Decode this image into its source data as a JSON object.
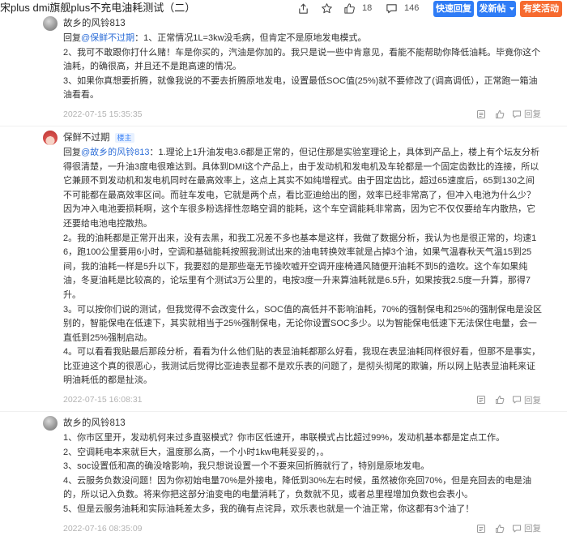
{
  "header": {
    "title": "宋plus dmi旗舰plus不充电油耗测试（二）",
    "share_icon": "share-icon",
    "favorite_icon": "star-icon",
    "like_icon": "thumb-up-icon",
    "like_count": "18",
    "comment_icon": "comment-icon",
    "comment_count": "146",
    "quick_reply_label": "快速回复",
    "new_post_label": "发新帖",
    "event_label": "有奖活动"
  },
  "posts": [
    {
      "author": "故乡的风铃813",
      "reply_prefix": "回复",
      "mention": "@保鲜不过期",
      "paragraphs": [
        "：1、正常情况1L=3kw没毛病，但肯定不是原地发电模式。",
        "2、我可不敢跟你打什么赌！车是你买的，汽油是你加的。我只是说一些中肯意见，看能不能帮助你降低油耗。毕竟你这个油耗，的确很高，并且还不是跑高速的情况。",
        "3、如果你真想要折腾，就像我说的不要去折腾原地发电，设置最低SOC值(25%)就不要修改了(调高调低），正常跑一箱油油看看。"
      ],
      "timestamp": "2022-07-15 15:35:35",
      "reply_label": "回复"
    },
    {
      "author": "保鲜不过期",
      "badge": "楼主",
      "reply_prefix": "回复",
      "mention": "@故乡的风铃813",
      "paragraphs": [
        "：1.理论上1升油发电3.6都是正常的，但记住那是实验室理论上，具体到产品上，楼上有个坛友分析得很清楚，一升油3度电很难达到。具体到DMI这个产品上，由于发动机和发电机及车轮都是一个固定齿数比的连接，所以它兼顾不到发动机和发电机同时在最高效率上，这点上其实不如纯增程式。由于固定齿比，超过65速度后，65到130之间不可能都在最高效率区间。而驻车发电，它就是两个点，看比亚迪给出的图，效率已经非常高了，但冲入电池为什么少？因为冲入电池要损耗啊，这个车很多粉选择性忽略空调的能耗，这个车空调能耗非常高，因为它不仅仅要给车内散热，它还要给电池电控散热。",
        "2。我的油耗都是正常开出来，没有去黑，和我工况差不多也基本是这样，我做了数据分析，我认为也是很正常的，均速16，跑100公里要用6小时，空调和基础能耗按照我测试出来的油电转换效率就是占掉3个油，如果气温春秋天气温15到25间，我的油耗一样是5升以下，我要怼的是那些毫无节操吹嘘开空调开座椅通风随便开油耗不到5的造吹。这个车如果纯油，冬夏油耗是比较高的，论坛里有个测试3万公里的，电按3度一升来算油耗就是6.5升，如果按我2.5度一升算，那得7升。",
        "3。可以按你们说的测试，但我觉得不会改变什么，SOC值的高低并不影响油耗，70%的强制保电和25%的强制保电是没区别的，智能保电在低速下，其实就相当于25%强制保电，无论你设置SOC多少。以为智能保电低速下无法保住电量，会一直低到25%强制启动。",
        "4。可以看看我贴最后那段分析，看看为什么他们贴的表显油耗都那么好看，我现在表显油耗同样很好看，但那不是事实，比亚迪这个真的很恶心，我测试后觉得比亚迪表显都不是欢乐表的问题了，是彻头彻尾的欺骗，所以网上贴表显油耗来证明油耗低的都是扯淡。"
      ],
      "timestamp": "2022-07-15 16:08:31",
      "reply_label": "回复"
    },
    {
      "author": "故乡的风铃813",
      "paragraphs": [
        "1、你市区里开，发动机何来过多直驱模式？你市区低速开，串联模式占比超过99%，发动机基本都是定点工作。",
        "2、空调耗电本来就巨大，温度那么高，一个小时1kw电耗妥妥的，。",
        "3、soc设置低和高的确没啥影响，我只想说设置一个不要来回折腾就行了，特别是原地发电。",
        "4、云服务负数没问题！因为你初始电量70%是外接电，降低到30%左右时候，虽然被你充回70%，但是充回去的电是油的，所以记入负数。将来你把这部分油变电的电量消耗了，负数就不见，或者总里程增加负数也会表小。",
        "5、但是云服务油耗和实际油耗差太多，我的确有点诧异，欢乐表也就是一个油正常，你这都有3个油了！"
      ],
      "timestamp": "2022-07-16 08:35:09",
      "reply_label": "回复"
    }
  ],
  "colors": {
    "primary_button": "#2f7cf6",
    "event_button": "#f66a2f",
    "mention": "#2f6fd8",
    "badge_text": "#3b82f6",
    "badge_bg": "#e8f1ff",
    "text": "#333333",
    "timestamp": "#b3b3b3"
  }
}
